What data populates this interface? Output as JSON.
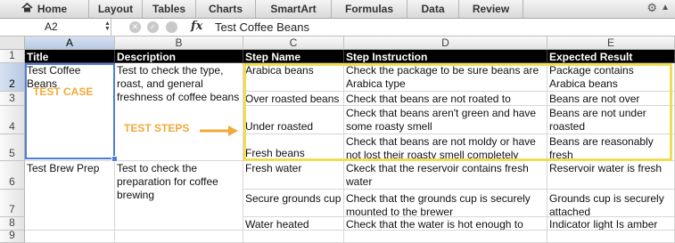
{
  "ribbon": {
    "tabs": [
      "Home",
      "Layout",
      "Tables",
      "Charts",
      "SmartArt",
      "Formulas",
      "Data",
      "Review"
    ]
  },
  "formula_bar": {
    "name_box": "A2",
    "fx": "fx",
    "value": "Test Coffee Beans"
  },
  "columns": [
    "A",
    "B",
    "C",
    "D",
    "E"
  ],
  "rows": [
    "1",
    "2",
    "3",
    "4",
    "5",
    "6",
    "7",
    "8",
    "9"
  ],
  "header": {
    "title": "Title",
    "description": "Description",
    "step_name": "Step Name",
    "step_instruction": "Step Instruction",
    "expected_result": "Expected Result"
  },
  "cells": {
    "a2": "Test Coffee Beans",
    "b2": "Test to check the type, roast, and general freshness of coffee beans",
    "c2": "Arabica beans",
    "d2": "Check the package to be sure beans are Arabica type",
    "e2": "Package contains Arabica beans",
    "c3": "Over roasted beans",
    "d3": "Check that beans are not roated to charcoal",
    "e3": "Beans are not over roasted",
    "c4": "Under roasted beans",
    "d4": "Check that beans aren't green and have some roasty smell",
    "e4": "Beans are not under roasted",
    "c5": "Fresh beans",
    "d5": "Check that beans are not moldy or have not lost their roasty smell completely",
    "e5": "Beans are reasonably fresh",
    "a6": "Test Brew Prep",
    "b6": "Test to check the preparation for coffee brewing",
    "c6": "Fresh water",
    "d6": "Ckeck that the reservoir contains fresh water",
    "e6": "Reservoir water is fresh",
    "c7": "Secure grounds cup",
    "d7": "Check that the grounds cup is securely mounted to the brewer",
    "e7": "Grounds cup is securely attached",
    "c8": "Water heated",
    "d8": "Check that the water is hot enough to brew",
    "e8": "Indicator light Is amber"
  },
  "annotations": {
    "test_case": "TEST CASE",
    "test_steps": "TEST STEPS"
  },
  "colors": {
    "highlight_box": "#f0dc55",
    "annotation": "#f2a93b",
    "selection": "#4e7fd6"
  }
}
